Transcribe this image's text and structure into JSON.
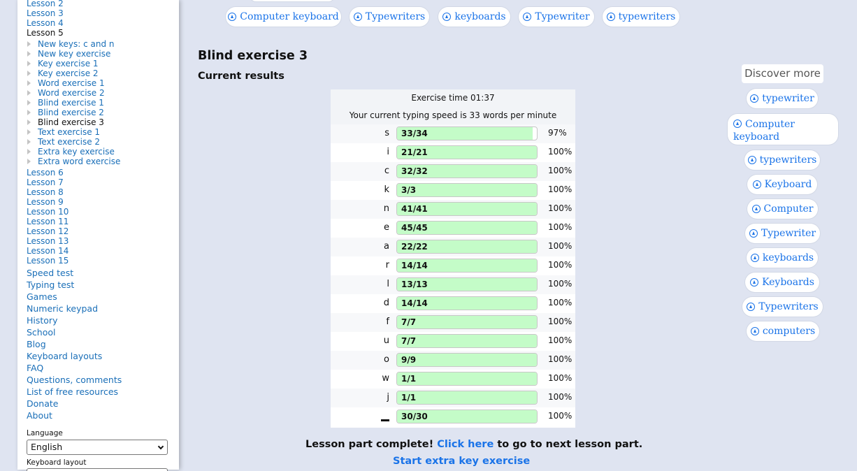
{
  "sidebar": {
    "lessons_before": [
      "Lesson 2",
      "Lesson 3",
      "Lesson 4"
    ],
    "current_lesson": "Lesson 5",
    "sub_items": [
      "New keys: c and n",
      "New key exercise",
      "Key exercise 1",
      "Key exercise 2",
      "Word exercise 1",
      "Word exercise 2",
      "Blind exercise 1",
      "Blind exercise 2",
      "Blind exercise 3",
      "Text exercise 1",
      "Text exercise 2",
      "Extra key exercise",
      "Extra word exercise"
    ],
    "current_sub_index": 8,
    "lessons_after": [
      "Lesson 6",
      "Lesson 7",
      "Lesson 8",
      "Lesson 9",
      "Lesson 10",
      "Lesson 11",
      "Lesson 12",
      "Lesson 13",
      "Lesson 14",
      "Lesson 15"
    ],
    "main_links": [
      "Speed test",
      "Typing test",
      "Games",
      "Numeric keypad",
      "History",
      "School",
      "Blog",
      "Keyboard layouts",
      "FAQ",
      "Questions, comments",
      "List of free resources",
      "Donate",
      "About"
    ],
    "language_label": "Language",
    "language_value": "English",
    "keyboard_layout_label": "Keyboard layout"
  },
  "top_pills": [
    "Computer keyboard",
    "Typewriters",
    "keyboards",
    "Typewriter",
    "typewriters"
  ],
  "main": {
    "title": "Blind exercise 3",
    "results_heading": "Current results",
    "exercise_time": "Exercise time 01:37",
    "speed_text": "Your current typing speed is 33 words per minute",
    "results": [
      {
        "key": "s",
        "correct": 33,
        "total": 34,
        "count": "33/34",
        "pct": "97%"
      },
      {
        "key": "i",
        "correct": 21,
        "total": 21,
        "count": "21/21",
        "pct": "100%"
      },
      {
        "key": "c",
        "correct": 32,
        "total": 32,
        "count": "32/32",
        "pct": "100%"
      },
      {
        "key": "k",
        "correct": 3,
        "total": 3,
        "count": "3/3",
        "pct": "100%"
      },
      {
        "key": "n",
        "correct": 41,
        "total": 41,
        "count": "41/41",
        "pct": "100%"
      },
      {
        "key": "e",
        "correct": 45,
        "total": 45,
        "count": "45/45",
        "pct": "100%"
      },
      {
        "key": "a",
        "correct": 22,
        "total": 22,
        "count": "22/22",
        "pct": "100%"
      },
      {
        "key": "r",
        "correct": 14,
        "total": 14,
        "count": "14/14",
        "pct": "100%"
      },
      {
        "key": "l",
        "correct": 13,
        "total": 13,
        "count": "13/13",
        "pct": "100%"
      },
      {
        "key": "d",
        "correct": 14,
        "total": 14,
        "count": "14/14",
        "pct": "100%"
      },
      {
        "key": "f",
        "correct": 7,
        "total": 7,
        "count": "7/7",
        "pct": "100%"
      },
      {
        "key": "u",
        "correct": 7,
        "total": 7,
        "count": "7/7",
        "pct": "100%"
      },
      {
        "key": "o",
        "correct": 9,
        "total": 9,
        "count": "9/9",
        "pct": "100%"
      },
      {
        "key": "w",
        "correct": 1,
        "total": 1,
        "count": "1/1",
        "pct": "100%"
      },
      {
        "key": "j",
        "correct": 1,
        "total": 1,
        "count": "1/1",
        "pct": "100%"
      },
      {
        "key": "space",
        "correct": 30,
        "total": 30,
        "count": "30/30",
        "pct": "100%"
      }
    ],
    "complete_prefix": "Lesson part complete!",
    "complete_link": "Click here",
    "complete_suffix": "to go to next lesson part.",
    "extra_link": "Start extra key exercise"
  },
  "discover": {
    "title": "Discover more",
    "pills": [
      "typewriter",
      "Computer keyboard",
      "typewriters",
      "Keyboard",
      "Computer",
      "Typewriter",
      "keyboards",
      "Keyboards",
      "Typewriters",
      "computers"
    ]
  },
  "colors": {
    "background": "#dfe4f1",
    "link": "#1a6fb8",
    "pill_text": "#1a73e8",
    "bar_fill": "#c4fcc8"
  }
}
